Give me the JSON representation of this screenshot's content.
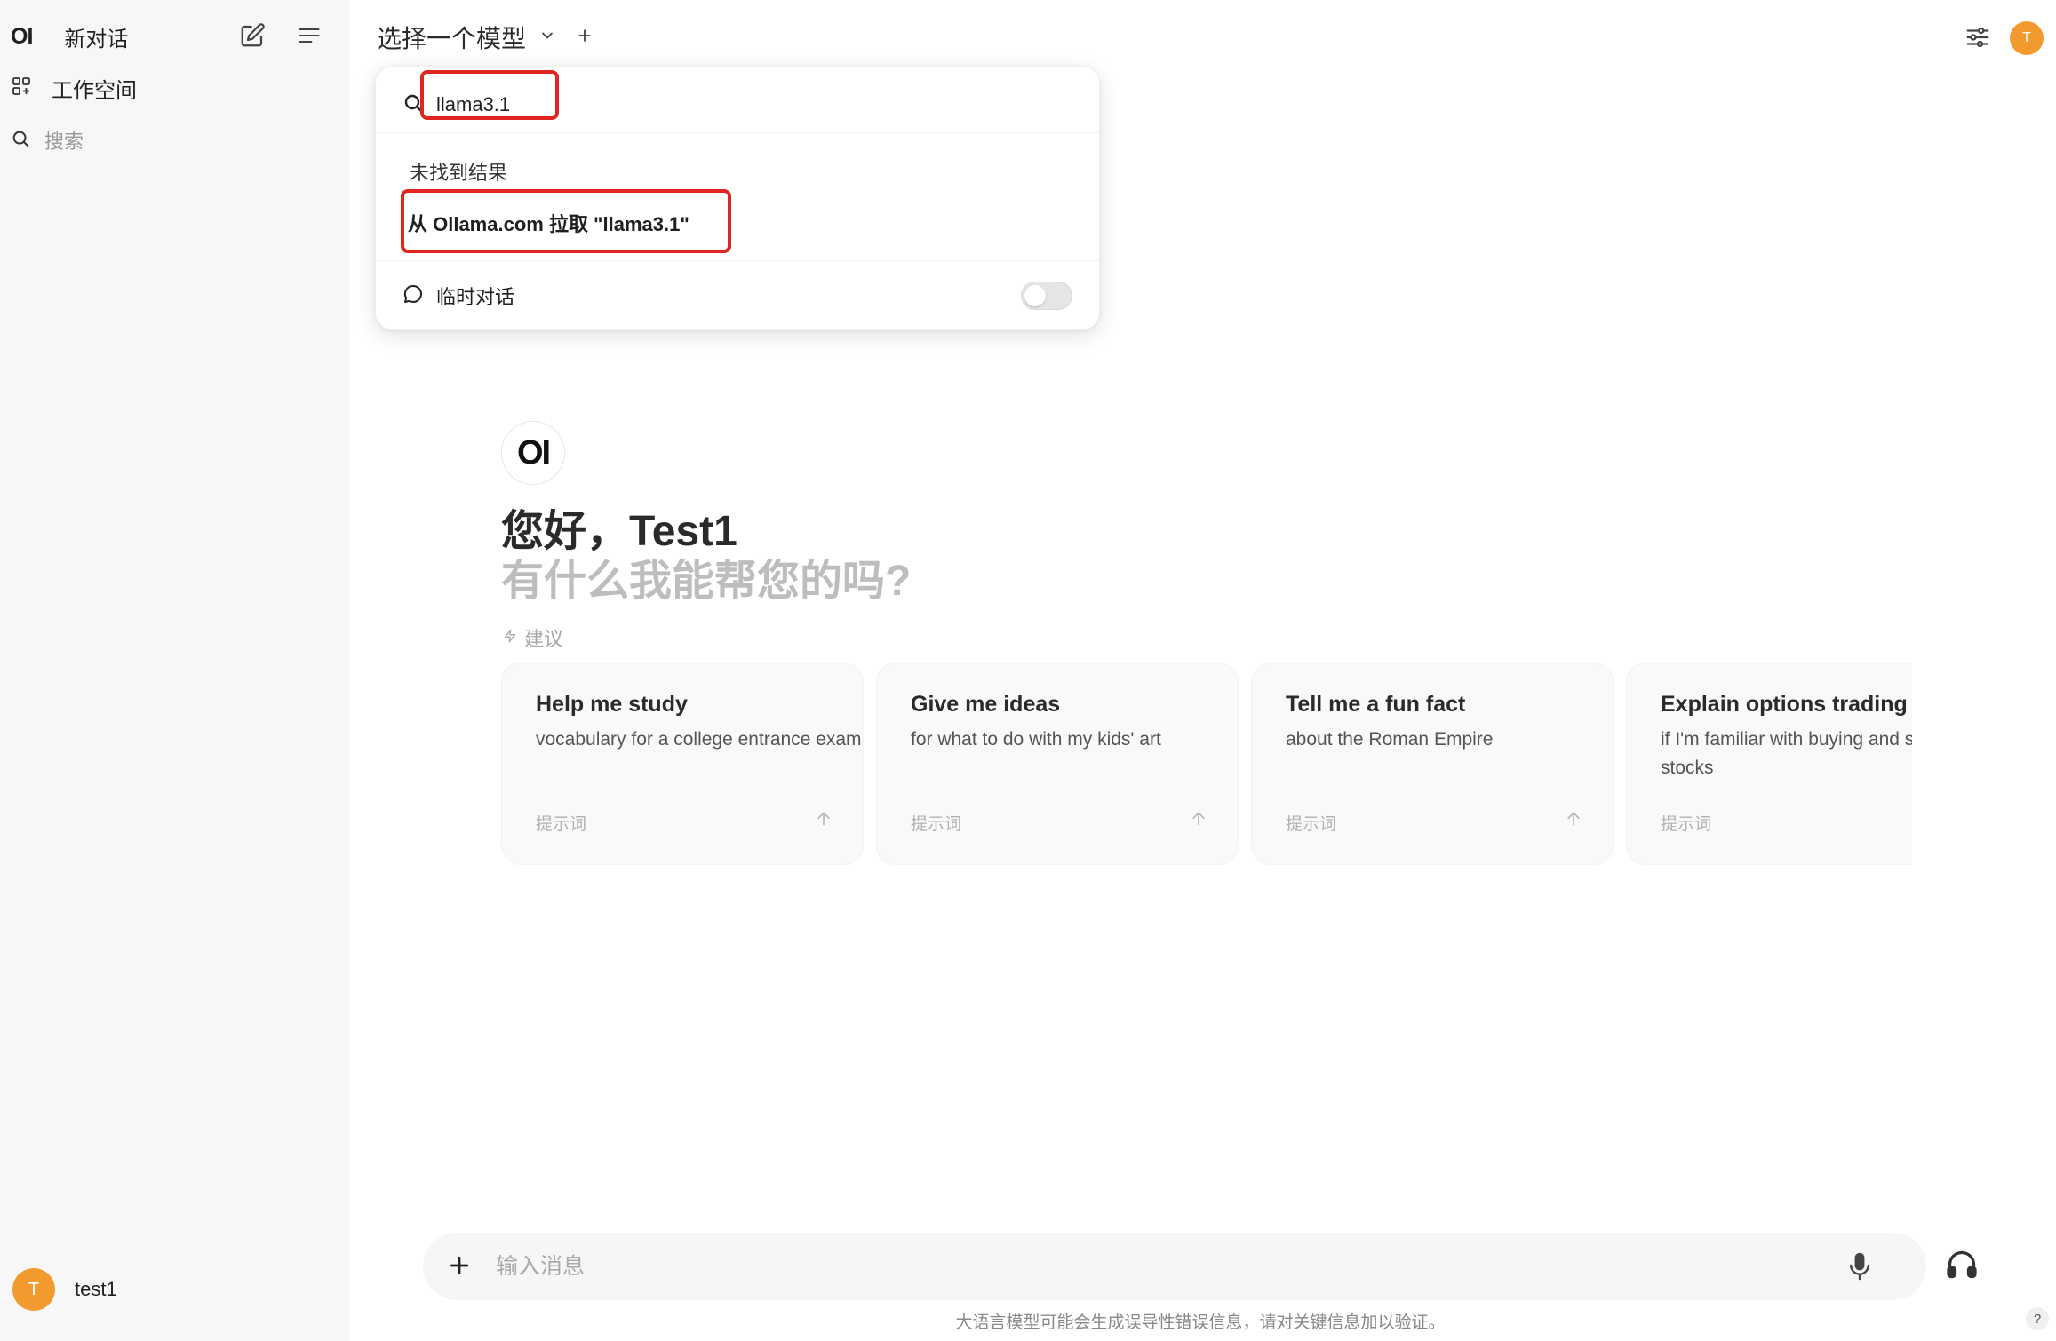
{
  "sidebar": {
    "logo": "OI",
    "new_chat_label": "新对话",
    "workspace_label": "工作空间",
    "search_label": "搜索",
    "user": {
      "avatar_letter": "T",
      "name": "test1",
      "avatar_color": "#f29a2e"
    }
  },
  "header": {
    "model_select_label": "选择一个模型",
    "user_avatar_letter": "T"
  },
  "dropdown": {
    "search_value": "llama3.1",
    "no_results": "未找到结果",
    "pull_label": "从 Ollama.com 拉取 \"llama3.1\"",
    "temp_chat_label": "临时对话",
    "temp_chat_enabled": false,
    "highlight_color": "#e0241f"
  },
  "main": {
    "logo": "OI",
    "greeting": "您好，Test1",
    "subtitle": "有什么我能帮您的吗?",
    "suggestions_label": "建议",
    "cards": [
      {
        "title": "Help me study",
        "desc": "vocabulary for a college entrance exam",
        "prompt": "提示词"
      },
      {
        "title": "Give me ideas",
        "desc": "for what to do with my kids' art",
        "prompt": "提示词"
      },
      {
        "title": "Tell me a fun fact",
        "desc": "about the Roman Empire",
        "prompt": "提示词"
      },
      {
        "title": "Explain options trading",
        "desc": "if I'm familiar with buying and selling stocks",
        "prompt": "提示词"
      }
    ]
  },
  "input": {
    "placeholder": "输入消息",
    "disclaimer": "大语言模型可能会生成误导性错误信息，请对关键信息加以验证。",
    "help": "?"
  }
}
